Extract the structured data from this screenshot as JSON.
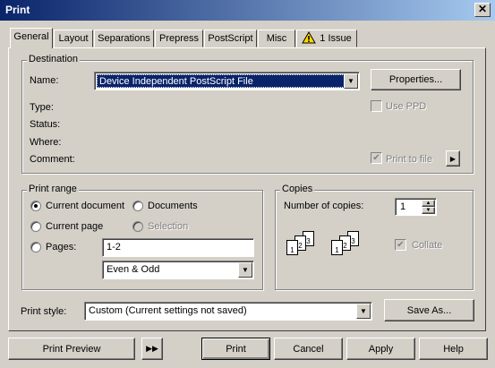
{
  "window": {
    "title": "Print",
    "close": "✕"
  },
  "tabs": [
    {
      "label": "General"
    },
    {
      "label": "Layout"
    },
    {
      "label": "Separations"
    },
    {
      "label": "Prepress"
    },
    {
      "label": "PostScript"
    },
    {
      "label": "Misc"
    },
    {
      "label": "1 Issue",
      "icon": "warning-icon"
    }
  ],
  "destination": {
    "legend": "Destination",
    "name_label": "Name:",
    "name_value": "Device Independent PostScript File",
    "properties_button": "Properties...",
    "type_label": "Type:",
    "status_label": "Status:",
    "where_label": "Where:",
    "comment_label": "Comment:",
    "use_ppd": "Use PPD",
    "print_to_file": "Print to file"
  },
  "print_range": {
    "legend": "Print range",
    "current_document": "Current document",
    "documents": "Documents",
    "current_page": "Current page",
    "selection": "Selection",
    "pages_label": "Pages:",
    "pages_value": "1-2",
    "page_filter": "Even & Odd"
  },
  "copies": {
    "legend": "Copies",
    "number_label": "Number of copies:",
    "number_value": "1",
    "collate": "Collate"
  },
  "print_style": {
    "label": "Print style:",
    "value": "Custom (Current settings not saved)",
    "save_as": "Save As..."
  },
  "footer": {
    "preview": "Print Preview",
    "print": "Print",
    "cancel": "Cancel",
    "apply": "Apply",
    "help": "Help"
  }
}
